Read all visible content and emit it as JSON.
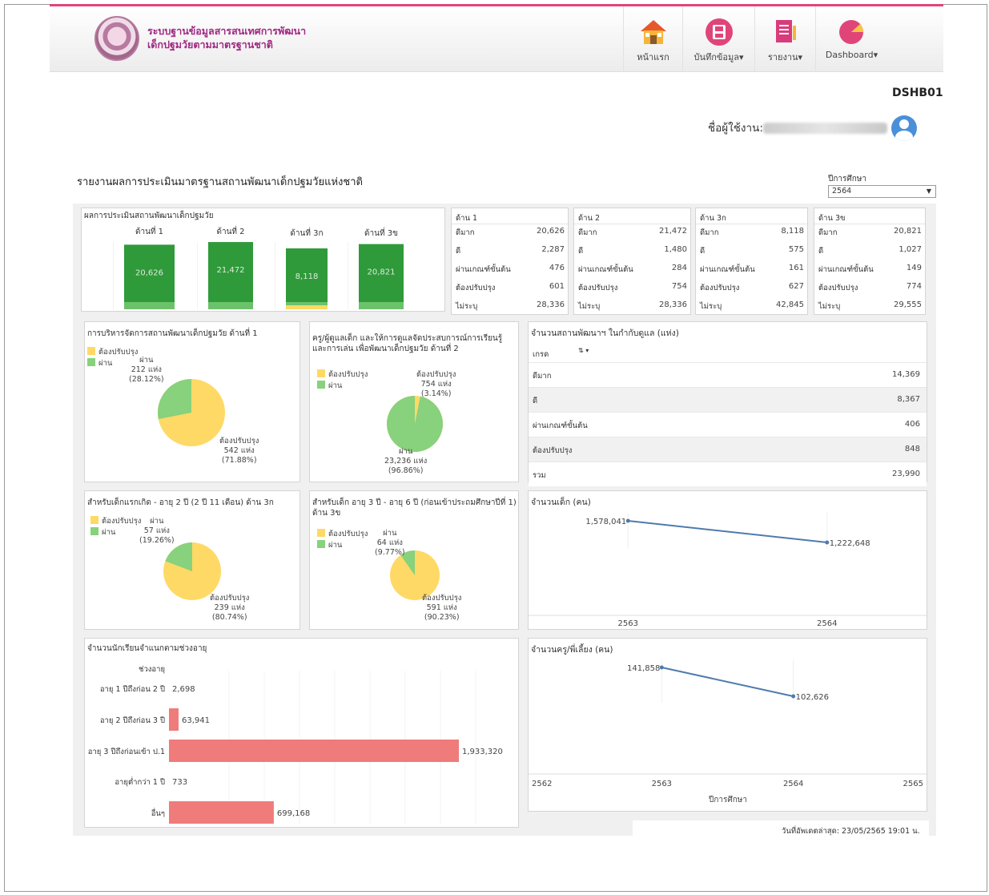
{
  "app": {
    "brand_line1": "ระบบฐานข้อมูลสารสนเทศการพัฒนา",
    "brand_line2": "เด็กปฐมวัยตามมาตรฐานชาติ",
    "accent_color": "#e0457a",
    "brand_color": "#a02a82"
  },
  "nav": [
    {
      "label": "หน้าแรก",
      "icon": "home-icon"
    },
    {
      "label": "บันทึกข้อมูล",
      "icon": "save-icon"
    },
    {
      "label": "รายงาน",
      "icon": "report-icon"
    },
    {
      "label": "Dashboard",
      "icon": "pie-chart-icon"
    }
  ],
  "page_code": "DSHB01",
  "user": {
    "label": "ชื่อผู้ใช้งาน:"
  },
  "report_title": "รายงานผลการประเมินมาตรฐานสถานพัฒนาเด็กปฐมวัยแห่งชาติ",
  "year_filter": {
    "label": "ปีการศึกษา",
    "value": "2564"
  },
  "assessment": {
    "title": "ผลการประเมินสถานพัฒนาเด็กปฐมวัย",
    "bars": [
      {
        "label": "ด้านที่ 1",
        "value": "20,626"
      },
      {
        "label": "ด้านที่ 2",
        "value": "21,472"
      },
      {
        "label": "ด้านที่ 3ก",
        "value": "8,118"
      },
      {
        "label": "ด้านที่ 3ข",
        "value": "20,821"
      }
    ]
  },
  "aspect_tables": [
    {
      "title": "ด้าน 1",
      "rows": [
        [
          "ดีมาก",
          "20,626"
        ],
        [
          "ดี",
          "2,287"
        ],
        [
          "ผ่านเกณฑ์ขั้นต้น",
          "476"
        ],
        [
          "ต้องปรับปรุง",
          "601"
        ],
        [
          "ไม่ระบุ",
          "28,336"
        ]
      ]
    },
    {
      "title": "ด้าน 2",
      "rows": [
        [
          "ดีมาก",
          "21,472"
        ],
        [
          "ดี",
          "1,480"
        ],
        [
          "ผ่านเกณฑ์ขั้นต้น",
          "284"
        ],
        [
          "ต้องปรับปรุง",
          "754"
        ],
        [
          "ไม่ระบุ",
          "28,336"
        ]
      ]
    },
    {
      "title": "ด้าน 3ก",
      "rows": [
        [
          "ดีมาก",
          "8,118"
        ],
        [
          "ดี",
          "575"
        ],
        [
          "ผ่านเกณฑ์ขั้นต้น",
          "161"
        ],
        [
          "ต้องปรับปรุง",
          "627"
        ],
        [
          "ไม่ระบุ",
          "42,845"
        ]
      ]
    },
    {
      "title": "ด้าน 3ข",
      "rows": [
        [
          "ดีมาก",
          "20,821"
        ],
        [
          "ดี",
          "1,027"
        ],
        [
          "ผ่านเกณฑ์ขั้นต้น",
          "149"
        ],
        [
          "ต้องปรับปรุง",
          "774"
        ],
        [
          "ไม่ระบุ",
          "29,555"
        ]
      ]
    }
  ],
  "legend": {
    "improve": "ต้องปรับปรุง",
    "pass": "ผ่าน",
    "improve_color": "#ffd966",
    "pass_color": "#88d17d"
  },
  "pies": [
    {
      "title": "การบริหารจัดการสถานพัฒนาเด็กปฐมวัย ด้านที่ 1",
      "pass_label": [
        "ผ่าน",
        "212 แห่ง",
        "(28.12%)"
      ],
      "improve_label": [
        "ต้องปรับปรุง",
        "542 แห่ง",
        "(71.88%)"
      ]
    },
    {
      "title": "ครู/ผู้ดูแลเด็ก และให้การดูแลจัดประสบการณ์การเรียนรู้ และการเล่น เพื่อพัฒนาเด็กปฐมวัย ด้านที่ 2",
      "pass_label": [
        "ผ่าน",
        "23,236 แห่ง",
        "(96.86%)"
      ],
      "improve_label": [
        "ต้องปรับปรุง",
        "754 แห่ง",
        "(3.14%)"
      ]
    },
    {
      "title": "สำหรับเด็กแรกเกิด - อายุ 2 ปี (2 ปี 11 เดือน) ด้าน 3ก",
      "pass_label": [
        "ผ่าน",
        "57 แห่ง",
        "(19.26%)"
      ],
      "improve_label": [
        "ต้องปรับปรุง",
        "239 แห่ง",
        "(80.74%)"
      ]
    },
    {
      "title": "สำหรับเด็ก อายุ 3 ปี - อายุ 6 ปี (ก่อนเข้าประถมศึกษาปีที่ 1) ด้าน 3ข",
      "pass_label": [
        "ผ่าน",
        "64 แห่ง",
        "(9.77%)"
      ],
      "improve_label": [
        "ต้องปรับปรุง",
        "591 แห่ง",
        "(90.23%)"
      ]
    }
  ],
  "grade_table": {
    "title": "จำนวนสถานพัฒนาฯ ในกำกับดูแล (แห่ง)",
    "header": "เกรด",
    "sort_icon": "sort-icon",
    "rows": [
      [
        "ดีมาก",
        "14,369"
      ],
      [
        "ดี",
        "8,367"
      ],
      [
        "ผ่านเกณฑ์ขั้นต้น",
        "406"
      ],
      [
        "ต้องปรับปรุง",
        "848"
      ],
      [
        "รวม",
        "23,990"
      ]
    ]
  },
  "children_line": {
    "title": "จำนวนเด็ก (คน)"
  },
  "teachers_line": {
    "title": "จำนวนครู/พี่เลี้ยง (คน)",
    "xlabel": "ปีการศึกษา"
  },
  "age_chart": {
    "title": "จำนวนนักเรียนจำแนกตามช่วงอายุ",
    "axis_header": "ช่วงอายุ"
  },
  "footer": {
    "updated": "วันที่อัพเดตล่าสุด: 23/05/2565 19:01 น."
  },
  "chart_data": [
    {
      "type": "bar",
      "title": "ผลการประเมินสถานพัฒนาเด็กปฐมวัย",
      "categories": [
        "ด้านที่ 1",
        "ด้านที่ 2",
        "ด้านที่ 3ก",
        "ด้านที่ 3ข"
      ],
      "series": [
        {
          "values": [
            20626,
            21472,
            8118,
            20821
          ]
        }
      ]
    },
    {
      "type": "pie",
      "title": "การบริหารจัดการสถานพัฒนาเด็กปฐมวัย ด้านที่ 1",
      "categories": [
        "ต้องปรับปรุง",
        "ผ่าน"
      ],
      "values": [
        542,
        212
      ]
    },
    {
      "type": "pie",
      "title": "ครู/ผู้ดูแลเด็ก และให้การดูแลจัดประสบการณ์การเรียนรู้ และการเล่น เพื่อพัฒนาเด็กปฐมวัย ด้านที่ 2",
      "categories": [
        "ต้องปรับปรุง",
        "ผ่าน"
      ],
      "values": [
        754,
        23236
      ]
    },
    {
      "type": "pie",
      "title": "สำหรับเด็กแรกเกิด - อายุ 2 ปี (2 ปี 11 เดือน) ด้าน 3ก",
      "categories": [
        "ต้องปรับปรุง",
        "ผ่าน"
      ],
      "values": [
        239,
        57
      ]
    },
    {
      "type": "pie",
      "title": "สำหรับเด็ก อายุ 3 ปี - อายุ 6 ปี (ก่อนเข้าประถมศึกษาปีที่ 1) ด้าน 3ข",
      "categories": [
        "ต้องปรับปรุง",
        "ผ่าน"
      ],
      "values": [
        591,
        64
      ]
    },
    {
      "type": "line",
      "title": "จำนวนเด็ก (คน)",
      "x": [
        2563,
        2564
      ],
      "series": [
        {
          "values": [
            1578041,
            1222648
          ],
          "labels": [
            "1,578,041",
            "1,222,648"
          ]
        }
      ],
      "xticks": [
        "2563",
        "2564"
      ]
    },
    {
      "type": "line",
      "title": "จำนวนครู/พี่เลี้ยง (คน)",
      "xlabel": "ปีการศึกษา",
      "x": [
        2563,
        2564
      ],
      "series": [
        {
          "values": [
            141858,
            102626
          ],
          "labels": [
            "141,858",
            "102,626"
          ]
        }
      ],
      "xticks": [
        "2562",
        "2563",
        "2564",
        "2565"
      ],
      "xlim": [
        2562,
        2565
      ]
    },
    {
      "type": "bar",
      "orientation": "horizontal",
      "title": "จำนวนนักเรียนจำแนกตามช่วงอายุ",
      "ylabel": "ช่วงอายุ",
      "categories": [
        "อายุ 1 ปีถึงก่อน 2 ปี",
        "อายุ 2 ปีถึงก่อน 3 ปี",
        "อายุ 3 ปีถึงก่อนเข้า ป.1",
        "อายุต่ำกว่า 1 ปี",
        "อื่นๆ"
      ],
      "values": [
        2698,
        63941,
        1933320,
        733,
        699168
      ],
      "labels": [
        "2,698",
        "63,941",
        "1,933,320",
        "733",
        "699,168"
      ]
    }
  ]
}
